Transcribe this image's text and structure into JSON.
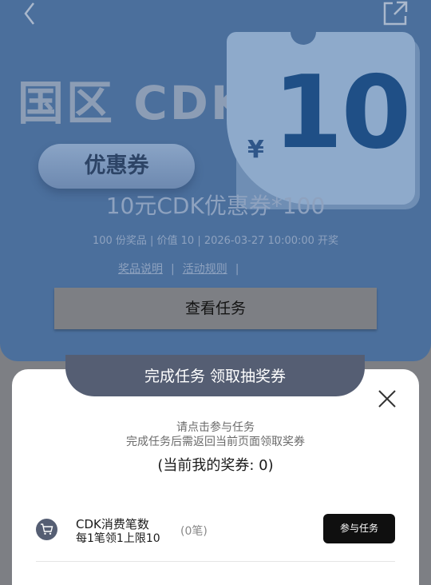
{
  "hero": {
    "big_title": "国区 CDK",
    "coupon_label": "优惠券",
    "ticket_currency": "¥",
    "ticket_value": "10",
    "prize_name": "10元CDK优惠券*100",
    "meta": "100 份奖品 | 价值 10 | 2026-03-27 10:00:00 开奖",
    "links": {
      "prize_info": "奖品说明",
      "rules": "活动规则",
      "separator": "|"
    },
    "view_tasks_button": "查看任务",
    "icons": {
      "back": "chevron-left-icon",
      "share": "share-icon"
    }
  },
  "sheet": {
    "header": "完成任务 领取抽奖券",
    "hint_line1": "请点击参与任务",
    "hint_line2": "完成任务后需返回当前页面领取奖券",
    "my_tickets": "(当前我的奖券: 0)",
    "close_icon": "close-icon",
    "tasks": [
      {
        "icon": "cart-icon",
        "title": "CDK消费笔数",
        "subtitle": "每1笔领1上限10",
        "count": "(0笔)",
        "button": "参与任务"
      }
    ]
  },
  "colors": {
    "hero_bg": "#4b6f9c",
    "overlay_bg": "#7d7f84",
    "sheet_tab": "#555e73",
    "ticket_number": "#1f4f86",
    "join_button": "#0f0f0f"
  }
}
